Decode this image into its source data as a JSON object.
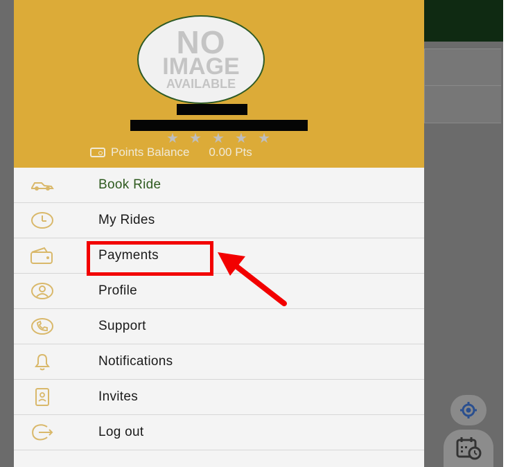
{
  "drawer": {
    "avatar": {
      "line1": "NO",
      "line2": "IMAGE",
      "line3": "AVAILABLE"
    },
    "rating_stars": "★★★★★",
    "points": {
      "label": "Points Balance",
      "value": "0.00 Pts"
    },
    "menu": [
      {
        "label": "Book Ride",
        "icon": "car-icon",
        "active": true
      },
      {
        "label": "My Rides",
        "icon": "clock-icon"
      },
      {
        "label": "Payments",
        "icon": "wallet-icon"
      },
      {
        "label": "Profile",
        "icon": "user-icon"
      },
      {
        "label": "Support",
        "icon": "phone-icon"
      },
      {
        "label": "Notifications",
        "icon": "bell-icon"
      },
      {
        "label": "Invites",
        "icon": "invite-icon"
      },
      {
        "label": "Log out",
        "icon": "logout-icon"
      }
    ]
  },
  "colors": {
    "header_bg": "#dcab38",
    "active_text": "#2e5a1f",
    "icon_color": "#d9b86a",
    "highlight": "#f20000"
  }
}
